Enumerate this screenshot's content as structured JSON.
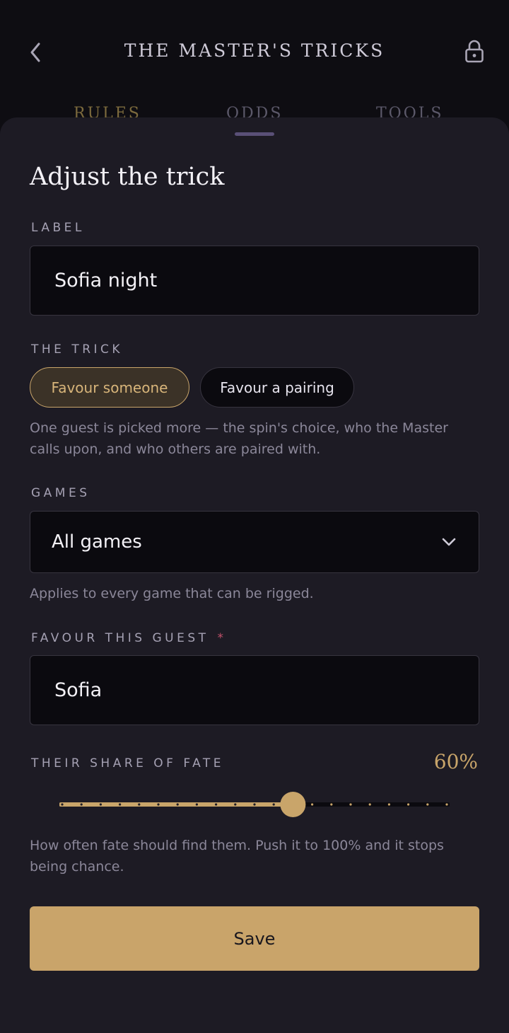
{
  "header": {
    "title": "THE MASTER'S TRICKS",
    "back_icon": "chevron-left-icon",
    "lock_icon": "lock-icon"
  },
  "tabs": [
    {
      "label": "RULES",
      "active": true
    },
    {
      "label": "ODDS",
      "active": false
    },
    {
      "label": "TOOLS",
      "active": false
    }
  ],
  "sheet": {
    "title": "Adjust the trick",
    "label_field": {
      "label": "LABEL",
      "value": "Sofia night"
    },
    "trick": {
      "label": "THE TRICK",
      "options": [
        {
          "label": "Favour someone",
          "selected": true
        },
        {
          "label": "Favour a pairing",
          "selected": false
        }
      ],
      "description": "One guest is picked more — the spin's choice, who the Master calls upon, and who others are paired with."
    },
    "games": {
      "label": "GAMES",
      "selected": "All games",
      "helper": "Applies to every game that can be rigged."
    },
    "guest": {
      "label": "FAVOUR THIS GUEST",
      "required_mark": "*",
      "value": "Sofia"
    },
    "share": {
      "label": "THEIR SHARE OF FATE",
      "value_text": "60%",
      "value": 0.6,
      "steps": 20,
      "helper": "How often fate should find them. Push it to 100% and it stops being chance."
    },
    "save_label": "Save"
  },
  "colors": {
    "accent": "#c9a56a",
    "background": "#0e0d12",
    "sheet": "#1d1b24",
    "input_bg": "#0b0a0f"
  }
}
